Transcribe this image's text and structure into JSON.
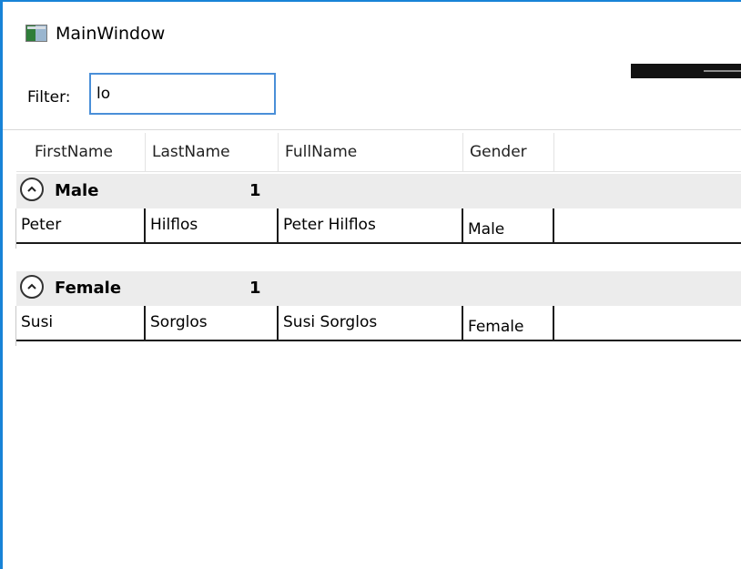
{
  "window": {
    "title": "MainWindow",
    "accent_color": "#1883d7",
    "icon": "app-window-icon"
  },
  "filter": {
    "label": "Filter:",
    "value": "lo"
  },
  "grid": {
    "columns": [
      "FirstName",
      "LastName",
      "FullName",
      "Gender"
    ],
    "groups": [
      {
        "name": "Male",
        "count": "1",
        "expander_icon": "chevron-up-icon",
        "rows": [
          {
            "first": "Peter",
            "last": "Hilflos",
            "full": "Peter Hilflos",
            "gender": "Male"
          }
        ]
      },
      {
        "name": "Female",
        "count": "1",
        "expander_icon": "chevron-up-icon",
        "rows": [
          {
            "first": "Susi",
            "last": "Sorglos",
            "full": "Susi Sorglos",
            "gender": "Female"
          }
        ]
      }
    ]
  }
}
